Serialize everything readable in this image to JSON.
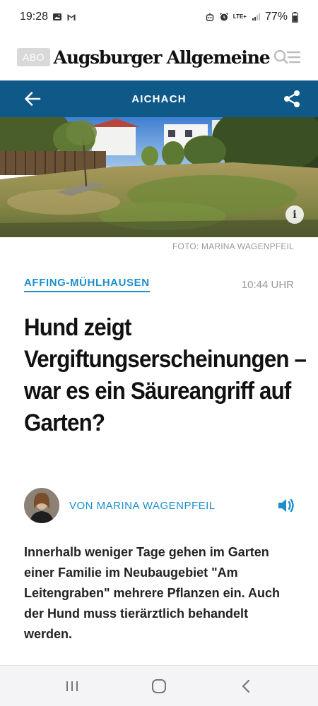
{
  "status_bar": {
    "time": "19:28",
    "network": "LTE+",
    "battery": "77%",
    "icons": [
      "gallery-icon",
      "gmail-icon",
      "alarm-icon",
      "signal-icon",
      "battery-icon"
    ]
  },
  "header": {
    "abo_label": "ABO",
    "logo_text": "Augsburger Allgemeine"
  },
  "section": {
    "title": "AICHACH"
  },
  "hero": {
    "photo_credit": "FOTO: MARINA WAGENPFEIL",
    "info_label": "i"
  },
  "article": {
    "location": "AFFING-MÜHLHAUSEN",
    "time": "10:44 UHR",
    "headline": "Hund zeigt Vergiftungserscheinungen – war es ein Säureangriff auf Garten?",
    "author": "VON MARINA WAGENPFEIL",
    "teaser": "Innerhalb weniger Tage gehen im Garten einer Familie im Neubaugebiet \"Am Leitengraben\" mehrere Pflanzen ein. Auch der Hund muss tierärztlich behandelt werden."
  },
  "colors": {
    "section_bar": "#0e5987",
    "accent": "#1b8fcc"
  }
}
